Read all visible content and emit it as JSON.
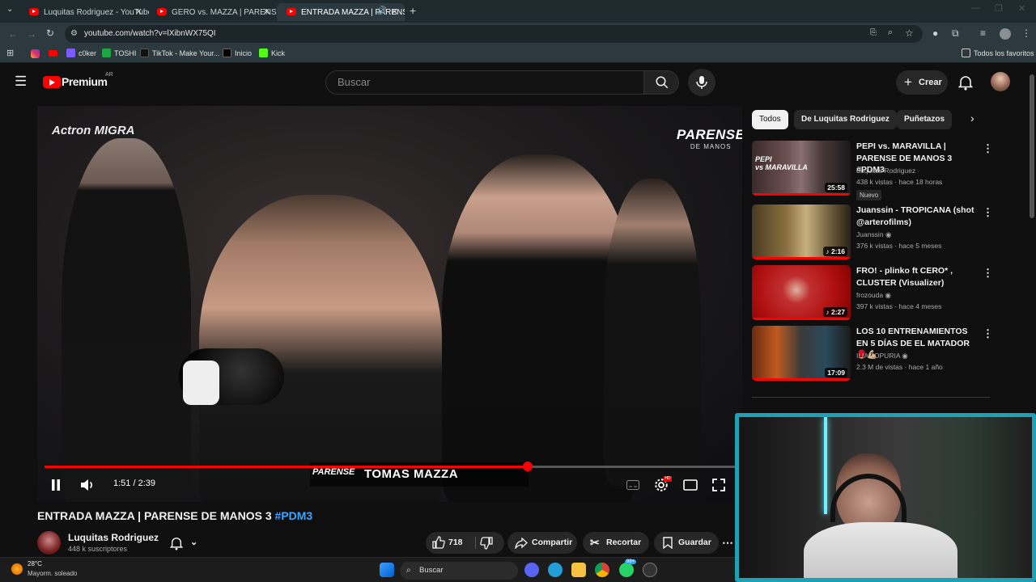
{
  "browser": {
    "tabs": [
      {
        "label": "Luquitas Rodriguez - YouTube"
      },
      {
        "label": "GERO vs. MAZZA | PARENSE DE"
      },
      {
        "label": "ENTRADA MAZZA | PARENS"
      }
    ],
    "url": "youtube.com/watch?v=lXibnWX75QI",
    "bookmarks": [
      "c0ker",
      "TOSHI",
      "TikTok - Make Your...",
      "Inicio",
      "Kick"
    ],
    "all_favorites": "Todos los favoritos"
  },
  "youtube": {
    "logo_text": "Premium",
    "region": "AR",
    "search_placeholder": "Buscar",
    "create_label": "Crear"
  },
  "player": {
    "current_time": "1:51 / 2:39",
    "progress": 0.7,
    "overlay_name": "TOMAS MAZZA",
    "overlay_brand": "PARENSE",
    "corner_logo": "PARENSE",
    "corner_logo_sub": "DE MANOS",
    "sponsor": "Actron MIGRA"
  },
  "video": {
    "title": "ENTRADA MAZZA | PARENSE DE MANOS 3",
    "hashtag": "#PDM3",
    "channel": "Luquitas Rodriguez",
    "subscribers": "448 k suscriptores",
    "likes": "718",
    "share_label": "Compartir",
    "clip_label": "Recortar",
    "save_label": "Guardar"
  },
  "sidebar": {
    "chips": [
      "Todos",
      "De Luquitas Rodriguez",
      "Puñetazos"
    ],
    "recommendations": [
      {
        "title": "PEPI vs. MARAVILLA | PARENSE DE MANOS 3 #PDM3",
        "channel": "Luquitas Rodriguez",
        "meta": "438 k vistas · hace 18 horas",
        "duration": "25:58",
        "badge": "Nuevo",
        "progress": 1.0
      },
      {
        "title": "Juanssin - TROPICANA (shot @arterofilms)",
        "channel": "Juanssin",
        "meta": "376 k vistas · hace 5 meses",
        "duration": "2:16",
        "progress": 1.0
      },
      {
        "title": "FRO! - plinko ft CERO* , CLUSTER (Visualizer)",
        "channel": "frozouda",
        "meta": "397 k vistas · hace 4 meses",
        "duration": "2:27",
        "progress": 1.0
      },
      {
        "title": "LOS 10 ENTRENAMIENTOS EN 5 DÍAS DE EL MATADOR 🥊💪🏼",
        "channel": "ILIA TOPURIA",
        "meta": "2.3 M de vistas · hace 1 año",
        "duration": "17:09",
        "progress": 1.0
      }
    ]
  },
  "taskbar": {
    "temperature": "28°C",
    "weather": "Mayorm. soleado",
    "search_placeholder": "Buscar",
    "notif_badge": "99+"
  },
  "colors": {
    "accent_red": "#ff0000",
    "link_blue": "#3ea6ff",
    "webcam_border": "#1ea0b5"
  }
}
